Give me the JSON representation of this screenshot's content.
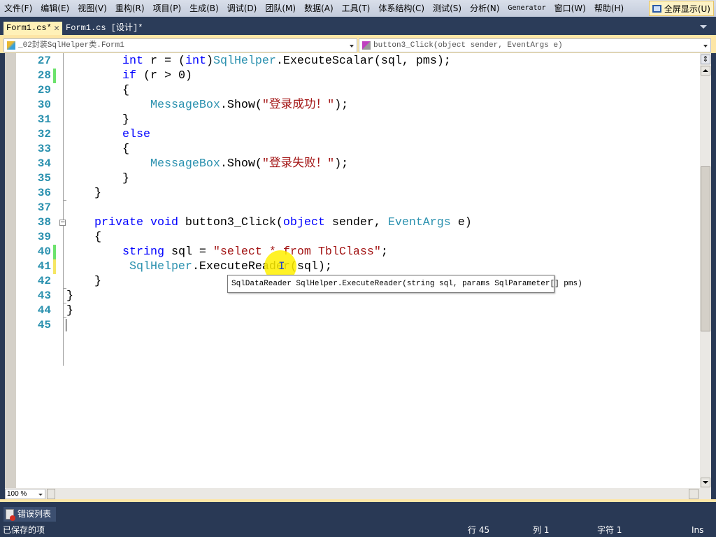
{
  "menu": [
    "文件(F)",
    "编辑(E)",
    "视图(V)",
    "重构(R)",
    "项目(P)",
    "生成(B)",
    "调试(D)",
    "团队(M)",
    "数据(A)",
    "工具(T)",
    "体系结构(C)",
    "测试(S)",
    "分析(N)",
    "Generator",
    "窗口(W)",
    "帮助(H)"
  ],
  "fullscreen_label": "全屏显示(U)",
  "tabs": [
    {
      "label": "Form1.cs*",
      "active": true
    },
    {
      "label": "Form1.cs [设计]*",
      "active": false
    }
  ],
  "nav": {
    "class_combo": "_02封装SqlHelper类.Form1",
    "member_combo": "button3_Click(object sender, EventArgs e)"
  },
  "code": [
    {
      "n": "27",
      "chg": "",
      "tokens": [
        [
          "pl",
          "        "
        ],
        [
          "kw",
          "int"
        ],
        [
          "pl",
          " r = ("
        ],
        [
          "kw",
          "int"
        ],
        [
          "pl",
          ")"
        ],
        [
          "ty",
          "SqlHelper"
        ],
        [
          "pl",
          ".ExecuteScalar(sql, pms);"
        ]
      ]
    },
    {
      "n": "28",
      "chg": "green",
      "tokens": [
        [
          "pl",
          "        "
        ],
        [
          "kw",
          "if"
        ],
        [
          "pl",
          " (r > 0)"
        ]
      ]
    },
    {
      "n": "29",
      "chg": "",
      "tokens": [
        [
          "pl",
          "        {"
        ]
      ]
    },
    {
      "n": "30",
      "chg": "",
      "tokens": [
        [
          "pl",
          "            "
        ],
        [
          "ty",
          "MessageBox"
        ],
        [
          "pl",
          ".Show("
        ],
        [
          "st",
          "\"登录成功！\""
        ],
        [
          "pl",
          ");"
        ]
      ]
    },
    {
      "n": "31",
      "chg": "",
      "tokens": [
        [
          "pl",
          "        }"
        ]
      ]
    },
    {
      "n": "32",
      "chg": "",
      "tokens": [
        [
          "pl",
          "        "
        ],
        [
          "kw",
          "else"
        ]
      ]
    },
    {
      "n": "33",
      "chg": "",
      "tokens": [
        [
          "pl",
          "        {"
        ]
      ]
    },
    {
      "n": "34",
      "chg": "",
      "tokens": [
        [
          "pl",
          "            "
        ],
        [
          "ty",
          "MessageBox"
        ],
        [
          "pl",
          ".Show("
        ],
        [
          "st",
          "\"登录失败！\""
        ],
        [
          "pl",
          ");"
        ]
      ]
    },
    {
      "n": "35",
      "chg": "",
      "tokens": [
        [
          "pl",
          "        }"
        ]
      ]
    },
    {
      "n": "36",
      "chg": "",
      "tokens": [
        [
          "pl",
          "    }"
        ]
      ]
    },
    {
      "n": "37",
      "chg": "",
      "tokens": []
    },
    {
      "n": "38",
      "chg": "",
      "tokens": [
        [
          "pl",
          "    "
        ],
        [
          "kw",
          "private"
        ],
        [
          "pl",
          " "
        ],
        [
          "kw",
          "void"
        ],
        [
          "pl",
          " button3_Click("
        ],
        [
          "kw",
          "object"
        ],
        [
          "pl",
          " sender, "
        ],
        [
          "ty",
          "EventArgs"
        ],
        [
          "pl",
          " e)"
        ]
      ]
    },
    {
      "n": "39",
      "chg": "",
      "tokens": [
        [
          "pl",
          "    {"
        ]
      ]
    },
    {
      "n": "40",
      "chg": "green",
      "tokens": [
        [
          "pl",
          "        "
        ],
        [
          "kw",
          "string"
        ],
        [
          "pl",
          " sql = "
        ],
        [
          "st",
          "\"select * from TblClass\""
        ],
        [
          "pl",
          ";"
        ]
      ]
    },
    {
      "n": "41",
      "chg": "yellow",
      "tokens": [
        [
          "pl",
          "         "
        ],
        [
          "ty",
          "SqlHelper"
        ],
        [
          "pl",
          ".ExecuteReader(sql);"
        ]
      ]
    },
    {
      "n": "42",
      "chg": "",
      "tokens": [
        [
          "pl",
          "    }"
        ]
      ]
    },
    {
      "n": "43",
      "chg": "",
      "tokens": [
        [
          "pl",
          "}"
        ]
      ]
    },
    {
      "n": "44",
      "chg": "",
      "tokens": [
        [
          "pl",
          "}"
        ]
      ]
    },
    {
      "n": "45",
      "chg": "",
      "tokens": []
    }
  ],
  "tooltip": "SqlDataReader SqlHelper.ExecuteReader(string sql, params SqlParameter[] pms)",
  "zoom_level": "100 %",
  "error_list_tab": "错误列表",
  "status": {
    "message": "已保存的项",
    "line": "行 45",
    "col": "列 1",
    "char": "字符 1",
    "mode": "Ins"
  },
  "colors": {
    "keyword": "#0000ff",
    "type": "#2b91af",
    "string": "#a31515",
    "line_number": "#2b91af",
    "change_saved": "#6ce26c",
    "change_unsaved": "#f5e663"
  }
}
